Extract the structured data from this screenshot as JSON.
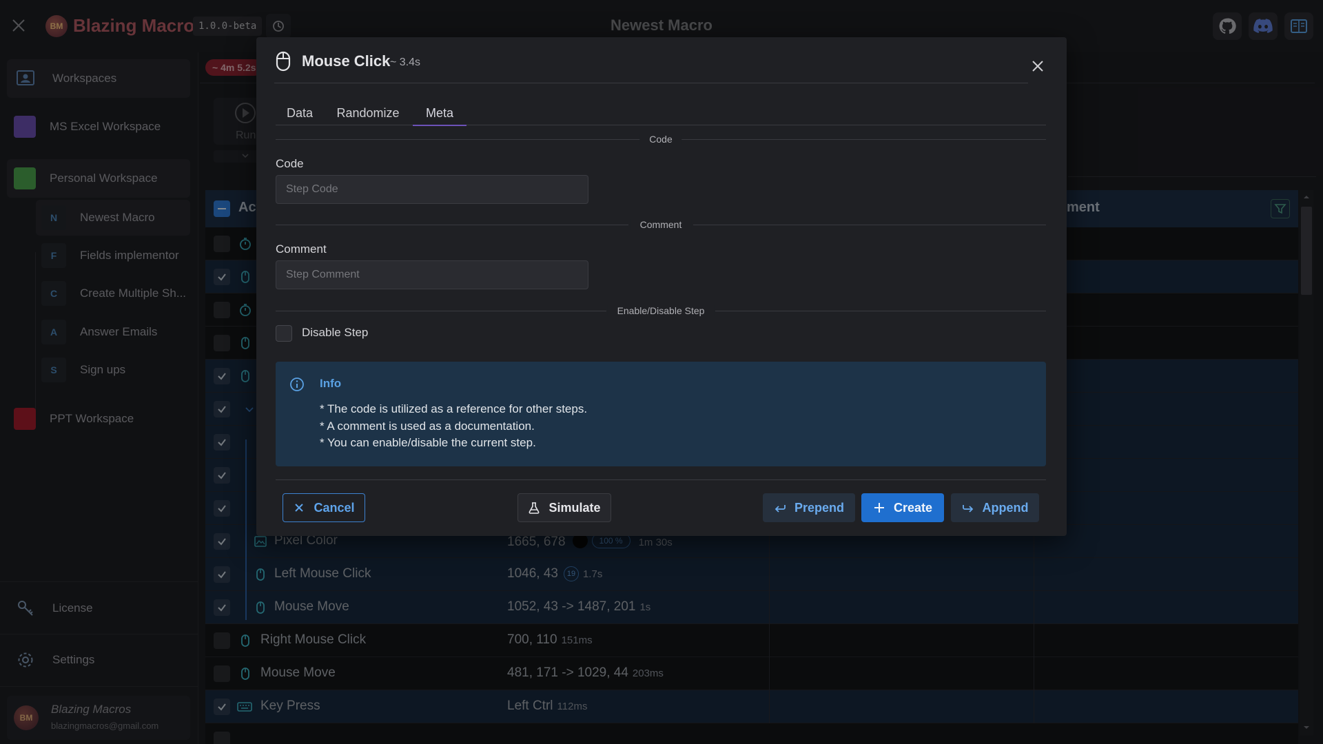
{
  "app": {
    "brand": "Blazing Macros",
    "logo_text": "BM",
    "version": "1.0.0-beta",
    "window_title": "Newest Macro"
  },
  "sidebar": {
    "workspaces_label": "Workspaces",
    "workspaces": [
      {
        "label": "MS Excel Workspace",
        "color": "#6a4fae"
      },
      {
        "label": "Personal Workspace",
        "color": "#4aa14d"
      },
      {
        "label": "PPT Workspace",
        "color": "#a01c2c"
      }
    ],
    "macros": [
      {
        "letter": "N",
        "label": "Newest Macro"
      },
      {
        "letter": "F",
        "label": "Fields implementor"
      },
      {
        "letter": "C",
        "label": "Create Multiple Sh..."
      },
      {
        "letter": "A",
        "label": "Answer Emails"
      },
      {
        "letter": "S",
        "label": "Sign ups"
      }
    ],
    "license_label": "License",
    "settings_label": "Settings",
    "user": {
      "name": "Blazing Macros",
      "email": "blazingmacros@gmail.com"
    }
  },
  "main": {
    "duration_badge": "~ 4m 5.2s",
    "run_label": "Run",
    "table_header_left": "Act",
    "table_header_right": "ment",
    "rows": [
      {
        "name": "Pixel Color",
        "value": "1665, 678",
        "pct": "100 %",
        "time": "1m 30s"
      },
      {
        "name": "Left Mouse Click",
        "value": "1046, 43",
        "count": "19",
        "time": "1.7s"
      },
      {
        "name": "Mouse Move",
        "value": "1052, 43 -> 1487, 201",
        "time": "1s"
      },
      {
        "name": "Right Mouse Click",
        "value": "700, 110",
        "time": "151ms"
      },
      {
        "name": "Mouse Move",
        "value": "481, 171 -> 1029, 44",
        "time": "203ms"
      },
      {
        "name": "Key Press",
        "value": "Left Ctrl",
        "time": "112ms"
      }
    ]
  },
  "modal": {
    "title": "Mouse Click",
    "duration": "~ 3.4s",
    "tabs": [
      "Data",
      "Randomize",
      "Meta"
    ],
    "active_tab": "Meta",
    "code_section": "Code",
    "code_label": "Code",
    "code_placeholder": "Step Code",
    "comment_section": "Comment",
    "comment_label": "Comment",
    "comment_placeholder": "Step Comment",
    "enable_section": "Enable/Disable Step",
    "disable_label": "Disable Step",
    "info": {
      "title": "Info",
      "lines": [
        "* The code is utilized as a reference for other steps.",
        "* A comment is used as a documentation.",
        "* You can enable/disable the current step."
      ]
    },
    "buttons": {
      "cancel": "Cancel",
      "simulate": "Simulate",
      "prepend": "Prepend",
      "create": "Create",
      "append": "Append"
    }
  }
}
